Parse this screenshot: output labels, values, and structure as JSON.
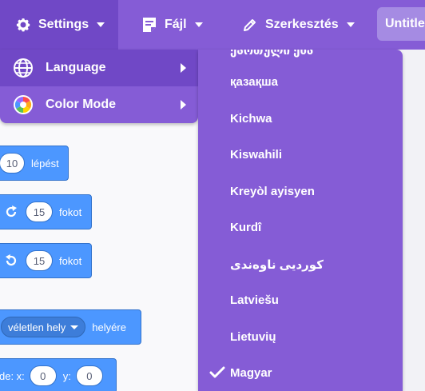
{
  "menubar": {
    "settings_label": "Settings",
    "file_label": "Fájl",
    "edit_label": "Szerkesztés",
    "project_title": "Untitled",
    "background_color": "#855cd6",
    "icons": [
      "gear-icon",
      "file-icon",
      "pencil-icon"
    ]
  },
  "settings_menu": {
    "items": [
      {
        "label": "Language",
        "icon": "globe-icon"
      },
      {
        "label": "Color Mode",
        "icon": "color-wheel-icon"
      }
    ]
  },
  "language_list": {
    "partial_top": "ქართული ენა",
    "items": [
      {
        "label": "қазақша",
        "selected": false
      },
      {
        "label": "Kichwa",
        "selected": false
      },
      {
        "label": "Kiswahili",
        "selected": false
      },
      {
        "label": "Kreyòl ayisyen",
        "selected": false
      },
      {
        "label": "Kurdî",
        "selected": false
      },
      {
        "label": "کوردیی ناوەندی",
        "selected": false
      },
      {
        "label": "Latviešu",
        "selected": false
      },
      {
        "label": "Lietuvių",
        "selected": false
      },
      {
        "label": "Magyar",
        "selected": true
      }
    ]
  },
  "blocks": {
    "move": {
      "value": "10",
      "label": "lépést"
    },
    "turn_right": {
      "value": "15",
      "label": "fokot"
    },
    "turn_left": {
      "value": "15",
      "label": "fokot"
    },
    "goto": {
      "dropdown": "véletlen hely",
      "label": "helyére"
    },
    "goto_xy": {
      "prefix": "de: x:",
      "x": "0",
      "y_label": "y:",
      "y": "0"
    }
  },
  "colors": {
    "menu_purple": "#855cd6",
    "menu_active": "#7048c6",
    "motion_blue": "#4c97ff"
  }
}
